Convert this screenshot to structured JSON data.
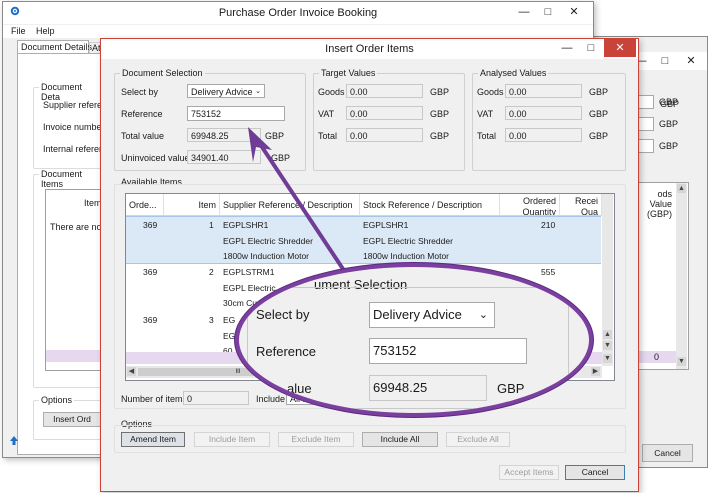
{
  "back_window": {
    "title": "Purchase Order Invoice Booking",
    "menu": [
      "File",
      "Help"
    ],
    "tabs": [
      "Document Details",
      "Att"
    ],
    "doc_group_label": "Document Deta",
    "supplier_label": "Supplier referenc",
    "invoice_label": "Invoice number",
    "internal_label": "Internal referenc",
    "currency": [
      "GBP",
      "GBP",
      "GBP"
    ],
    "doc_items_label": "Document Items",
    "item_col": "Item",
    "goods_value_col": "ods Value (GBP)",
    "no_items_text": "There are no it",
    "zero_value": "0",
    "options_label": "Options",
    "insert_button": "Insert Ord",
    "cancel_button": "Cancel"
  },
  "dialog": {
    "title": "Insert Order Items",
    "document_selection": {
      "label": "Document Selection",
      "select_by_label": "Select by",
      "select_by_value": "Delivery Advice",
      "reference_label": "Reference",
      "reference_value": "753152",
      "total_value_label": "Total value",
      "total_value": "69948.25",
      "total_currency": "GBP",
      "uninvoiced_label": "Uninvoiced value",
      "uninvoiced_value": "34901.40",
      "uninvoiced_currency": "GBP"
    },
    "target_values": {
      "label": "Target Values",
      "goods_label": "Goods",
      "goods": "0.00",
      "vat_label": "VAT",
      "vat": "0.00",
      "total_label": "Total",
      "total": "0.00",
      "currency": "GBP"
    },
    "analysed_values": {
      "label": "Analysed Values",
      "goods_label": "Goods",
      "goods": "0.00",
      "vat_label": "VAT",
      "vat": "0.00",
      "total_label": "Total",
      "total": "0.00",
      "currency": "GBP"
    },
    "available_items": {
      "label": "Available Items",
      "columns": [
        "Orde...",
        "Item",
        "Supplier Reference / Description",
        "Stock Reference / Description",
        "Ordered Quantity",
        "Recei Qua"
      ],
      "rows": [
        {
          "order": "369",
          "item": "1",
          "supplier": [
            "EGPLSHR1",
            "EGPL Electric Shredder",
            "1800w Induction Motor"
          ],
          "stock": [
            "EGPLSHR1",
            "EGPL Electric Shredder",
            "1800w Induction Motor"
          ],
          "qty": "210"
        },
        {
          "order": "369",
          "item": "2",
          "supplier": [
            "EGPLSTRM1",
            "EGPL Electric",
            "30cm Cu"
          ],
          "stock": [],
          "qty": "555"
        },
        {
          "order": "369",
          "item": "3",
          "supplier": [
            "EG",
            "EG",
            "60"
          ],
          "stock": [],
          "qty": ""
        }
      ],
      "hscroll_glyph": "III"
    },
    "number_of_items_label": "Number of items",
    "number_of_items": "0",
    "include_label": "Include",
    "include_value": "All Items",
    "options": {
      "label": "Options",
      "amend": "Amend Item",
      "include_item": "Include Item",
      "exclude_item": "Exclude Item",
      "include_all": "Include All",
      "exclude_all": "Exclude All"
    },
    "accept_button": "Accept Items",
    "cancel_button": "Cancel"
  },
  "magnifier": {
    "title": "ument Selection",
    "select_by_label": "Select by",
    "select_by_value": "Delivery Advice",
    "reference_label": "Reference",
    "reference_value": "753152",
    "total_label": "alue",
    "total_value": "69948.25",
    "currency": "GBP"
  },
  "colors": {
    "dialog_border": "#c94339",
    "selected_row": "#dbe9f7",
    "magnifier_ring": "#7b3fa0",
    "close_button": "#c94339"
  }
}
